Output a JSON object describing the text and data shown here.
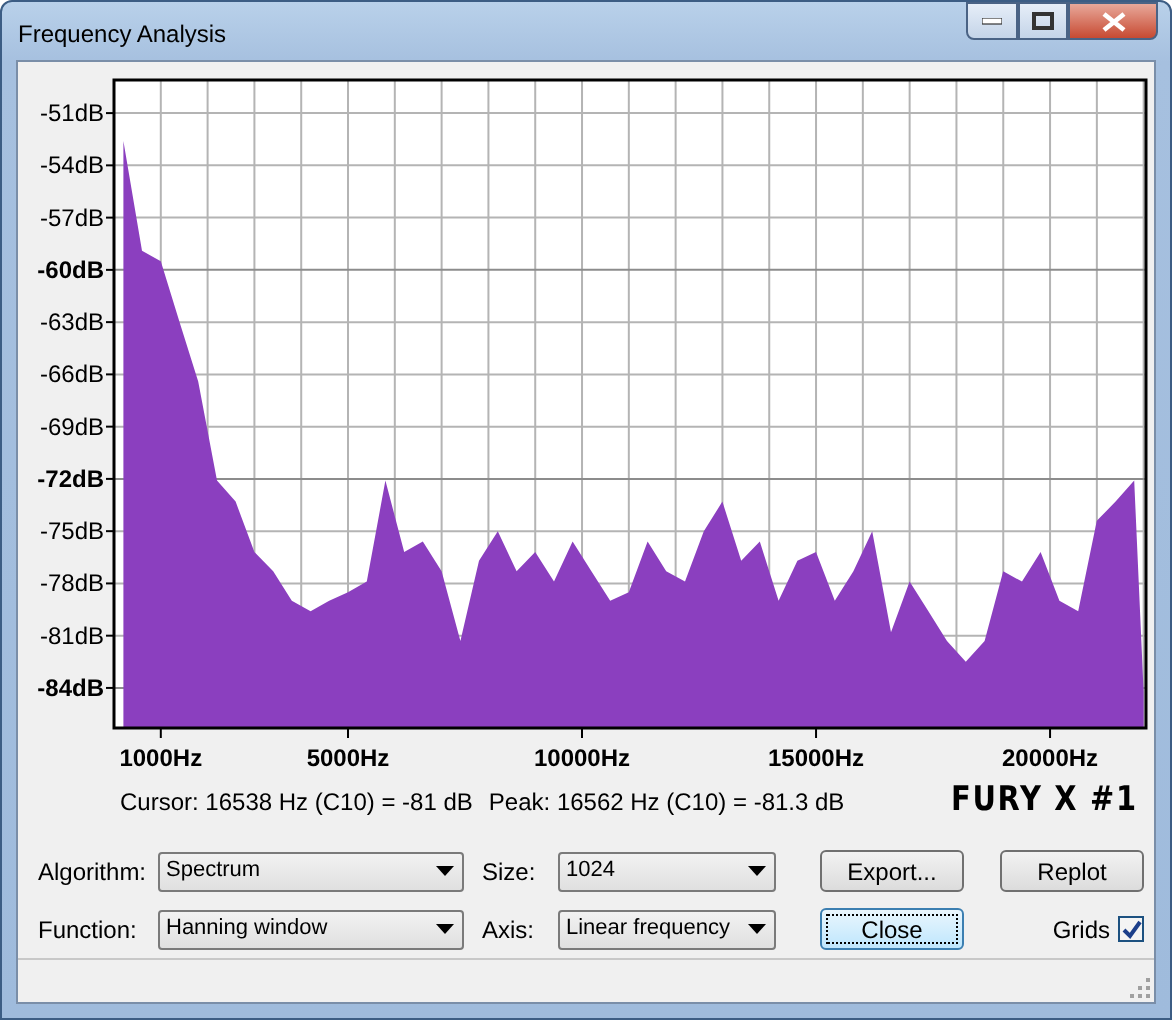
{
  "window": {
    "title": "Frequency Analysis"
  },
  "spectrum": {
    "chart_data": {
      "type": "area",
      "grid": true,
      "xlim": [
        0,
        22050
      ],
      "ylim": [
        -86.3,
        -49.1
      ],
      "xticks": [
        {
          "value": 1000,
          "label": "1000Hz"
        },
        {
          "value": 5000,
          "label": "5000Hz"
        },
        {
          "value": 10000,
          "label": "10000Hz"
        },
        {
          "value": 15000,
          "label": "15000Hz"
        },
        {
          "value": 20000,
          "label": "20000Hz"
        }
      ],
      "yticks": [
        {
          "value": -51,
          "label": "-51dB"
        },
        {
          "value": -54,
          "label": "-54dB"
        },
        {
          "value": -57,
          "label": "-57dB"
        },
        {
          "value": -60,
          "label": "-60dB"
        },
        {
          "value": -63,
          "label": "-63dB"
        },
        {
          "value": -66,
          "label": "-66dB"
        },
        {
          "value": -69,
          "label": "-69dB"
        },
        {
          "value": -72,
          "label": "-72dB"
        },
        {
          "value": -75,
          "label": "-75dB"
        },
        {
          "value": -78,
          "label": "-78dB"
        },
        {
          "value": -81,
          "label": "-81dB"
        },
        {
          "value": -84,
          "label": "-84dB"
        }
      ],
      "x": [
        200,
        600,
        1000,
        1400,
        1800,
        2200,
        2600,
        3000,
        3400,
        3800,
        4200,
        4600,
        5000,
        5400,
        5800,
        6200,
        6600,
        7000,
        7400,
        7800,
        8200,
        8600,
        9000,
        9400,
        9800,
        10200,
        10600,
        11000,
        11400,
        11800,
        12200,
        12600,
        13000,
        13400,
        13800,
        14200,
        14600,
        15000,
        15400,
        15800,
        16200,
        16600,
        17000,
        17400,
        17800,
        18200,
        18600,
        19000,
        19400,
        19800,
        20200,
        20600,
        21000,
        21400,
        21800,
        22000
      ],
      "series": [
        {
          "color": "#8b3fbf",
          "values": [
            -52.6,
            -58.9,
            -59.5,
            -63,
            -66.4,
            -72.1,
            -73.3,
            -76.2,
            -77.3,
            -79,
            -79.6,
            -79,
            -78.5,
            -77.9,
            -72.1,
            -76.2,
            -75.6,
            -77.3,
            -81.3,
            -76.7,
            -75,
            -77.3,
            -76.2,
            -77.9,
            -75.6,
            -77.3,
            -79,
            -78.5,
            -75.6,
            -77.3,
            -77.9,
            -75,
            -73.3,
            -76.7,
            -75.6,
            -79,
            -76.7,
            -76.2,
            -79,
            -77.3,
            -75,
            -80.8,
            -77.9,
            -79.6,
            -81.3,
            -82.5,
            -81.3,
            -77.3,
            -77.9,
            -76.2,
            -79,
            -79.6,
            -74.4,
            -73.3,
            -72.1,
            -84.2
          ]
        }
      ]
    }
  },
  "readout": {
    "cursor": "Cursor: 16538 Hz (C10) = -81 dB",
    "peak": "Peak: 16562 Hz (C10) = -81.3 dB"
  },
  "annotation": "FURY X #1",
  "controls": [
    [
      {
        "kind": "label",
        "text": "Algorithm:"
      },
      {
        "kind": "select",
        "value": "Spectrum"
      },
      {
        "kind": "label",
        "text": "Size:"
      },
      {
        "kind": "select",
        "value": "1024"
      },
      {
        "kind": "button",
        "text": "Export...",
        "focused": false
      },
      {
        "kind": "button",
        "text": "Replot",
        "focused": false
      }
    ],
    [
      {
        "kind": "label",
        "text": "Function:"
      },
      {
        "kind": "select",
        "value": "Hanning window"
      },
      {
        "kind": "label",
        "text": "Axis:"
      },
      {
        "kind": "select",
        "value": "Linear frequency"
      },
      {
        "kind": "button",
        "text": "Close",
        "focused": true
      },
      {
        "kind": "checkbox",
        "text": "Grids",
        "checked": true
      }
    ]
  ]
}
